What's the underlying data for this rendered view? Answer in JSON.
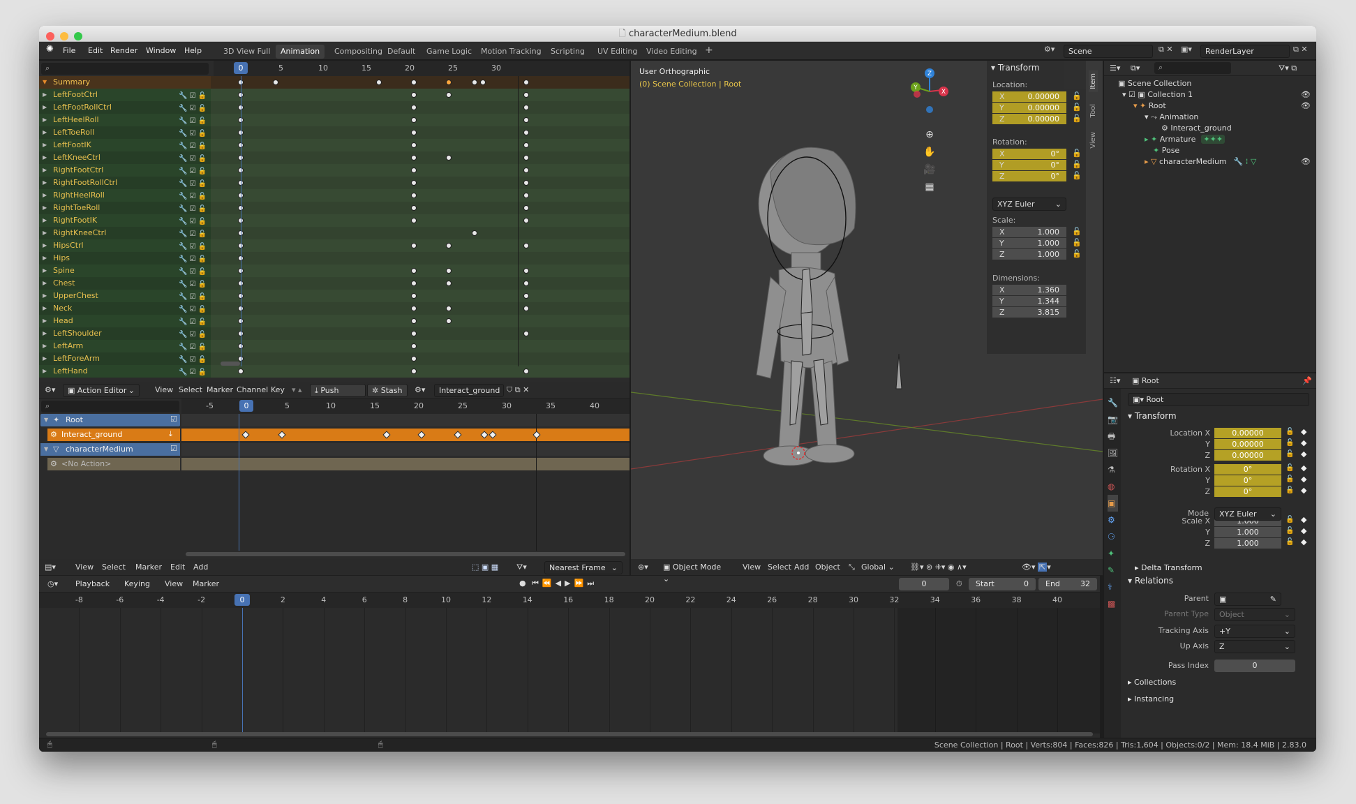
{
  "window": {
    "title": "characterMedium.blend"
  },
  "menu": {
    "items": [
      "File",
      "Edit",
      "Render",
      "Window",
      "Help"
    ]
  },
  "workspaces": [
    "3D View Full",
    "Animation",
    "Compositing",
    "Default",
    "Game Logic",
    "Motion Tracking",
    "Scripting",
    "UV Editing",
    "Video Editing"
  ],
  "workspace_active": "Animation",
  "scene": {
    "name": "Scene",
    "render_layer": "RenderLayer"
  },
  "dopesheet": {
    "current_frame": "0",
    "ruler": [
      "5",
      "10",
      "15",
      "20",
      "25",
      "30"
    ],
    "summary": "Summary",
    "channels": [
      "LeftFootCtrl",
      "LeftFootRollCtrl",
      "LeftHeelRoll",
      "LeftToeRoll",
      "LeftFootIK",
      "LeftKneeCtrl",
      "RightFootCtrl",
      "RightFootRollCtrl",
      "RightHeelRoll",
      "RightToeRoll",
      "RightFootIK",
      "RightKneeCtrl",
      "HipsCtrl",
      "Hips",
      "Spine",
      "Chest",
      "UpperChest",
      "Neck",
      "Head",
      "LeftShoulder",
      "LeftArm",
      "LeftForeArm",
      "LeftHand"
    ],
    "header": {
      "mode": "Action Editor",
      "view": "View",
      "select": "Select",
      "marker": "Marker",
      "channel": "Channel",
      "key": "Key",
      "push_down": "Push Down",
      "stash": "Stash",
      "action": "Interact_ground"
    }
  },
  "nla": {
    "current_frame": "0",
    "ruler": [
      "-5",
      "5",
      "10",
      "15",
      "20",
      "25",
      "30",
      "35",
      "40"
    ],
    "tracks": {
      "root": "Root",
      "action": "Interact_ground",
      "mesh": "characterMedium",
      "no_action": "<No Action>"
    },
    "header": {
      "view": "View",
      "select": "Select",
      "marker": "Marker",
      "edit": "Edit",
      "add": "Add",
      "snap": "Nearest Frame"
    }
  },
  "viewport": {
    "title": "User Orthographic",
    "subtitle": "(0) Scene Collection | Root",
    "header": {
      "mode": "Object Mode",
      "view": "View",
      "select": "Select",
      "add": "Add",
      "object": "Object",
      "orientation": "Global"
    },
    "tabs": [
      "Item",
      "Tool",
      "View"
    ],
    "gizmo_axes": {
      "x": "X",
      "y": "Y",
      "z": "Z"
    },
    "axis_colors": {
      "x": "#d8344b",
      "y": "#6ca11b",
      "z": "#2f82d8"
    },
    "transform": {
      "title": "Transform",
      "location_label": "Location:",
      "rotation_label": "Rotation:",
      "scale_label": "Scale:",
      "dimensions_label": "Dimensions:",
      "location": [
        "0.00000",
        "0.00000",
        "0.00000"
      ],
      "rotation": [
        "0°",
        "0°",
        "0°"
      ],
      "rotation_mode": "XYZ Euler",
      "scale": [
        "1.000",
        "1.000",
        "1.000"
      ],
      "dimensions": [
        "1.360",
        "1.344",
        "3.815"
      ],
      "axes": [
        "X",
        "Y",
        "Z"
      ]
    }
  },
  "timeline": {
    "header": {
      "playback": "Playback",
      "keying": "Keying",
      "view": "View",
      "marker": "Marker"
    },
    "frame": "0",
    "start_label": "Start",
    "start": "0",
    "end_label": "End",
    "end": "32",
    "current_frame": "0",
    "ruler": [
      "-8",
      "-6",
      "-4",
      "-2",
      "2",
      "4",
      "6",
      "8",
      "10",
      "12",
      "14",
      "16",
      "18",
      "20",
      "22",
      "24",
      "26",
      "28",
      "30",
      "32",
      "34",
      "36",
      "38",
      "40"
    ]
  },
  "outliner": {
    "scene_collection": "Scene Collection",
    "collection": "Collection 1",
    "root": "Root",
    "animation": "Animation",
    "action": "Interact_ground",
    "armature": "Armature",
    "pose": "Pose",
    "mesh": "characterMedium"
  },
  "properties": {
    "object": "Root",
    "object_field": "Root",
    "transform_title": "Transform",
    "location_labels": [
      "Location X",
      "Y",
      "Z"
    ],
    "location": [
      "0.00000",
      "0.00000",
      "0.00000"
    ],
    "rotation_labels": [
      "Rotation X",
      "Y",
      "Z"
    ],
    "rotation": [
      "0°",
      "0°",
      "0°"
    ],
    "mode_label": "Mode",
    "mode": "XYZ Euler",
    "scale_labels": [
      "Scale X",
      "Y",
      "Z"
    ],
    "scale": [
      "1.000",
      "1.000",
      "1.000"
    ],
    "delta_transform": "Delta Transform",
    "relations": "Relations",
    "parent_label": "Parent",
    "parent_type_label": "Parent Type",
    "parent_type": "Object",
    "tracking_axis_label": "Tracking Axis",
    "tracking_axis": "+Y",
    "up_axis_label": "Up Axis",
    "up_axis": "Z",
    "pass_index_label": "Pass Index",
    "pass_index": "0",
    "collections": "Collections",
    "instancing": "Instancing"
  },
  "status": {
    "text": "Scene Collection | Root | Verts:804 | Faces:826 | Tris:1,604 | Objects:0/2 | Mem: 18.4 MiB | 2.83.0"
  }
}
